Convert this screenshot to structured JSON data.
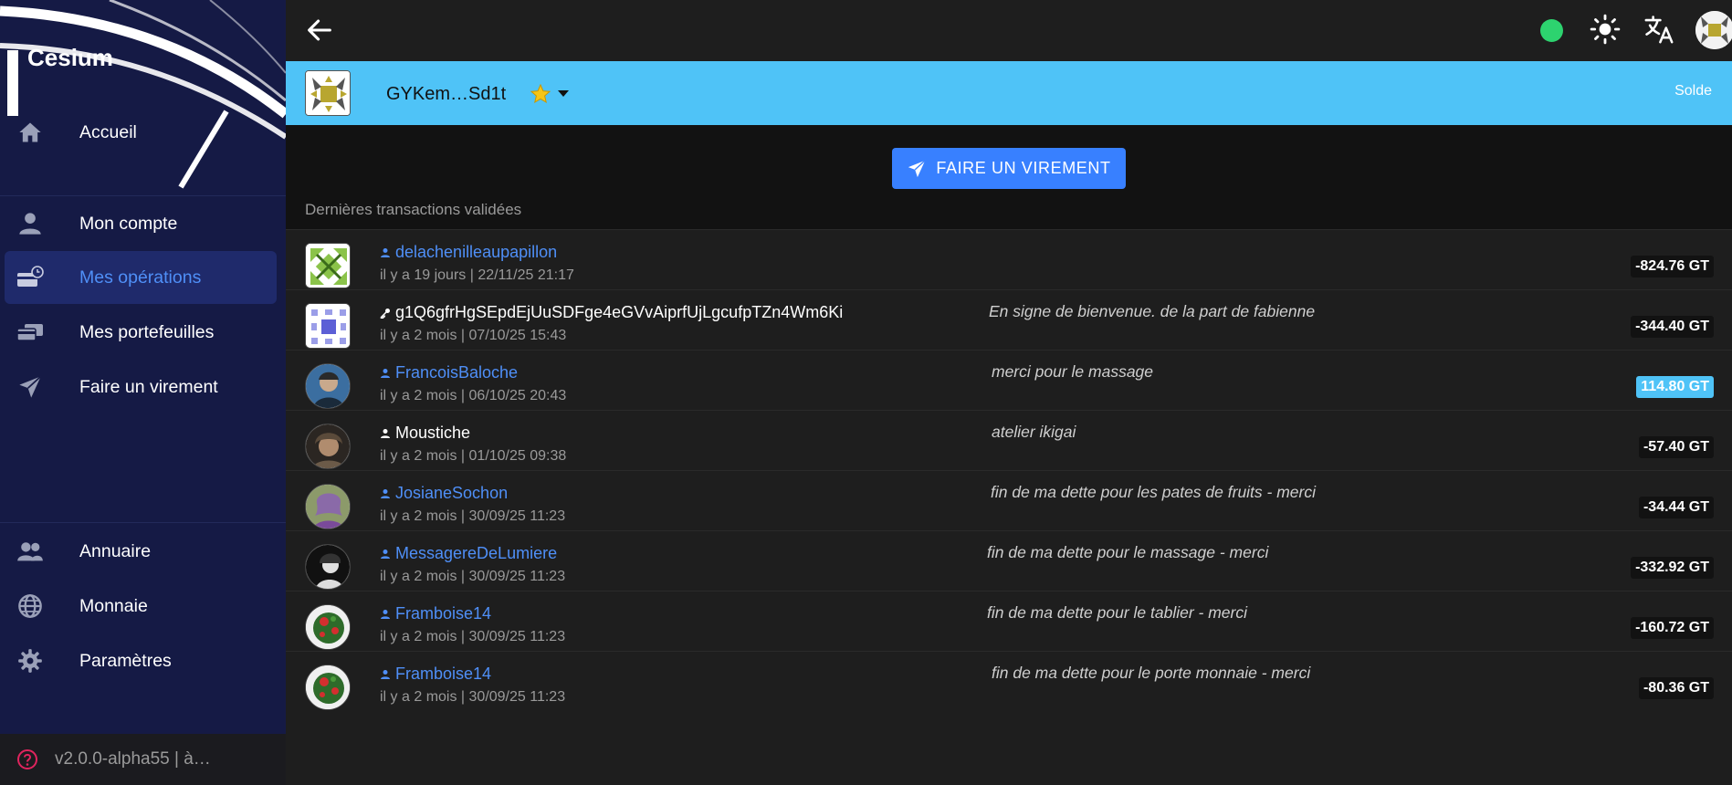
{
  "app": {
    "logo": "Cesium"
  },
  "sidebar": {
    "items": [
      {
        "label": "Accueil",
        "icon": "home-icon",
        "active": false
      },
      {
        "label": "Mon compte",
        "icon": "person-icon",
        "active": false
      },
      {
        "label": "Mes opérations",
        "icon": "card-history-icon",
        "active": true
      },
      {
        "label": "Mes portefeuilles",
        "icon": "cards-icon",
        "active": false
      },
      {
        "label": "Faire un virement",
        "icon": "paper-plane-icon",
        "active": false
      },
      {
        "label": "Annuaire",
        "icon": "people-icon",
        "active": false
      },
      {
        "label": "Monnaie",
        "icon": "globe-icon",
        "active": false
      },
      {
        "label": "Paramètres",
        "icon": "gear-icon",
        "active": false
      }
    ],
    "footer": {
      "version": "v2.0.0-alpha55 | à…",
      "icon": "help-circle-icon"
    }
  },
  "topbar": {
    "back_icon": "arrow-back-icon",
    "status_color": "#2dd36f",
    "theme_icon": "sun-icon",
    "language_icon": "translate-icon"
  },
  "account": {
    "name": "GYKem…Sd1t",
    "favorite_icon": "star-icon",
    "balance_label": "Solde",
    "color": "#4fc3f7"
  },
  "transfer_button": {
    "label": "FAIRE UN VIREMENT",
    "icon": "paper-plane-icon",
    "color": "#3880ff"
  },
  "transactions_heading": "Dernières transactions validées",
  "transactions": [
    {
      "name": "delachenilleaupapillon",
      "identity": "member",
      "date": "il y a 19 jours | 22/11/25 21:17",
      "comment": "",
      "amount": "-824.76 GT",
      "positive": false
    },
    {
      "name": "g1Q6gfrHgSEpdEjUuSDFge4eGVvAiprfUjLgcufpTZn4Wm6Ki",
      "identity": "pubkey",
      "date": "il y a 2 mois | 07/10/25 15:43",
      "comment": "En signe de bienvenue. de la part de fabienne",
      "amount": "-344.40 GT",
      "positive": false
    },
    {
      "name": "FrancoisBaloche",
      "identity": "member",
      "date": "il y a 2 mois | 06/10/25 20:43",
      "comment": "merci pour le massage",
      "amount": "114.80 GT",
      "positive": true
    },
    {
      "name": "Moustiche",
      "identity": "person",
      "date": "il y a 2 mois | 01/10/25 09:38",
      "comment": "atelier ikigai",
      "amount": "-57.40 GT",
      "positive": false
    },
    {
      "name": "JosianeSochon",
      "identity": "member",
      "date": "il y a 2 mois | 30/09/25 11:23",
      "comment": "fin de ma dette pour les pates de fruits - merci",
      "amount": "-34.44 GT",
      "positive": false
    },
    {
      "name": "MessagereDeLumiere",
      "identity": "member",
      "date": "il y a 2 mois | 30/09/25 11:23",
      "comment": "fin de ma dette pour le massage - merci",
      "amount": "-332.92 GT",
      "positive": false
    },
    {
      "name": "Framboise14",
      "identity": "member",
      "date": "il y a 2 mois | 30/09/25 11:23",
      "comment": "fin de ma dette pour le tablier - merci",
      "amount": "-160.72 GT",
      "positive": false
    },
    {
      "name": "Framboise14",
      "identity": "member",
      "date": "il y a 2 mois | 30/09/25 11:23",
      "comment": "fin de ma dette pour le porte monnaie - merci",
      "amount": "-80.36 GT",
      "positive": false
    }
  ]
}
